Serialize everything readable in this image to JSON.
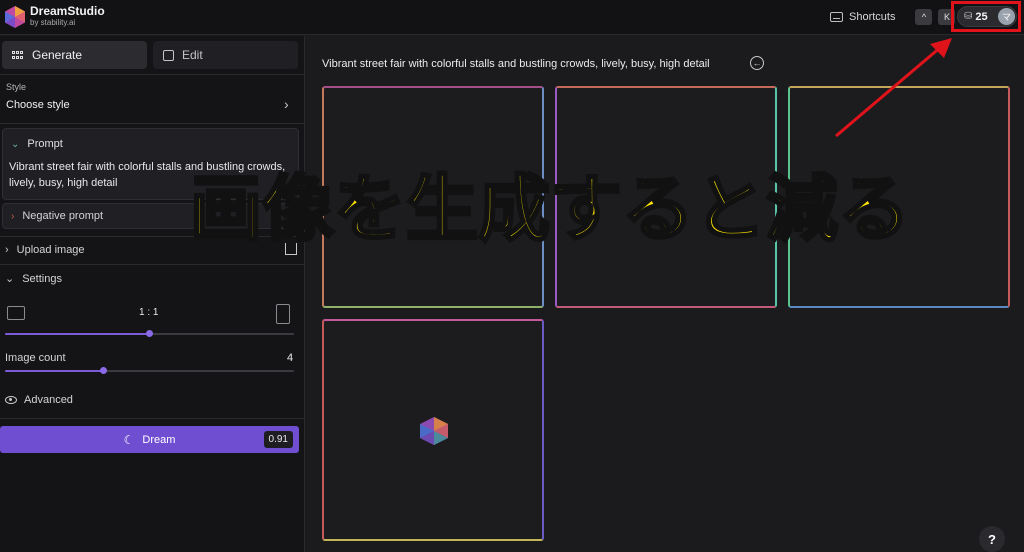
{
  "app": {
    "name": "DreamStudio",
    "subtitle": "by stability.ai"
  },
  "topbar": {
    "shortcuts_label": "Shortcuts",
    "key_1": "^",
    "key_2": "K",
    "credits": "25",
    "avatar_initial": "マ"
  },
  "sidebar": {
    "tabs": [
      {
        "label": "Generate"
      },
      {
        "label": "Edit"
      }
    ],
    "style_label": "Style",
    "style_value": "Choose style",
    "prompt_title": "Prompt",
    "prompt_text": "Vibrant street fair with colorful stalls and bustling crowds, lively, busy, high detail",
    "negative_prompt": "Negative prompt",
    "upload_image": "Upload image",
    "settings": "Settings",
    "aspect_ratio": "1 : 1",
    "image_count_label": "Image count",
    "image_count": "4",
    "advanced": "Advanced",
    "dream_label": "Dream",
    "dream_cost": "0.91"
  },
  "main": {
    "prompt_text": "Vibrant street fair with colorful stalls and bustling crowds, lively, busy, high detail"
  },
  "overlay": {
    "text": "画像を生成すると減る"
  },
  "help": "?",
  "colors": {
    "accent": "#6f4ed1",
    "overlay_text": "#ffe600",
    "highlight_box": "#e0131b"
  }
}
